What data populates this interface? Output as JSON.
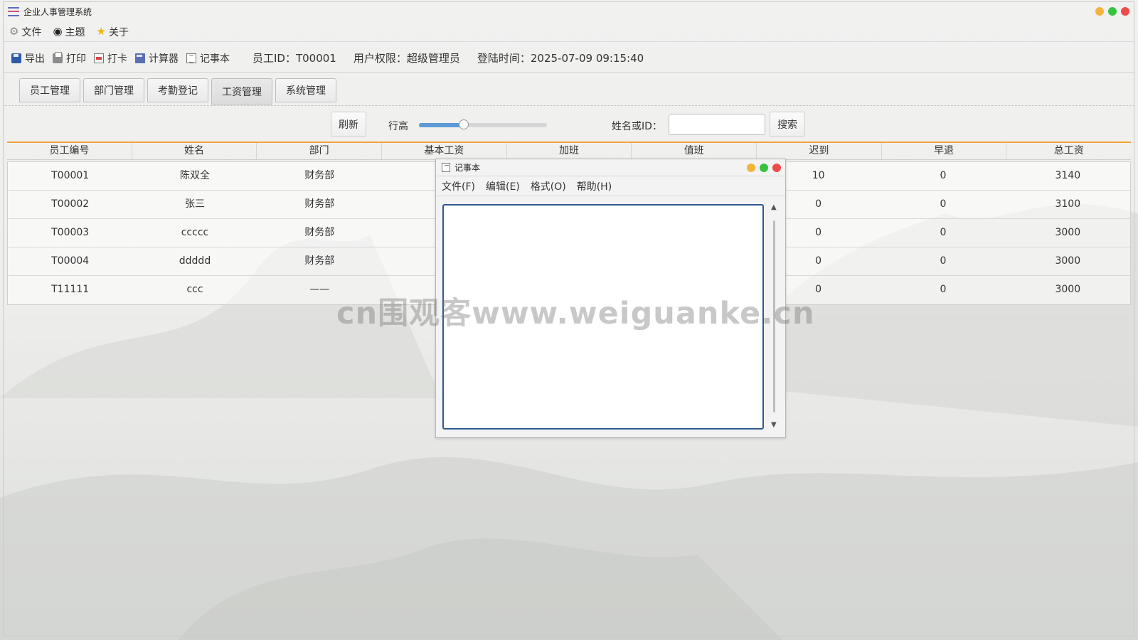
{
  "app": {
    "title": "企业人事管理系统"
  },
  "menubar": [
    {
      "label": "文件",
      "icon": "gear-icon"
    },
    {
      "label": "主题",
      "icon": "eye-icon"
    },
    {
      "label": "关于",
      "icon": "star-icon"
    }
  ],
  "toolbar": {
    "items": [
      {
        "label": "导出",
        "icon": "save-icon"
      },
      {
        "label": "打印",
        "icon": "printer-icon"
      },
      {
        "label": "打卡",
        "icon": "punch-card-icon"
      },
      {
        "label": "计算器",
        "icon": "calculator-icon"
      },
      {
        "label": "记事本",
        "icon": "notepad-icon"
      }
    ],
    "employee_id": "员工ID：T00001",
    "permission": "用户权限：超级管理员",
    "login_time": "登陆时间：2025-07-09 09:15:40"
  },
  "tabs": [
    {
      "label": "员工管理"
    },
    {
      "label": "部门管理"
    },
    {
      "label": "考勤登记"
    },
    {
      "label": "工资管理",
      "active": true
    },
    {
      "label": "系统管理"
    }
  ],
  "controls": {
    "refresh_label": "刷新",
    "row_height_label": "行高",
    "row_height_value": 0.35,
    "search_label": "姓名或ID：",
    "search_value": "",
    "search_button": "搜索"
  },
  "table": {
    "columns": [
      "员工编号",
      "姓名",
      "部门",
      "基本工资",
      "加班",
      "值班",
      "迟到",
      "早退",
      "总工资"
    ],
    "rows": [
      [
        "T00001",
        "陈双全",
        "财务部",
        "",
        "",
        "",
        "10",
        "0",
        "3140"
      ],
      [
        "T00002",
        "张三",
        "财务部",
        "",
        "",
        "",
        "0",
        "0",
        "3100"
      ],
      [
        "T00003",
        "ccccc",
        "财务部",
        "",
        "",
        "",
        "0",
        "0",
        "3000"
      ],
      [
        "T00004",
        "ddddd",
        "财务部",
        "",
        "",
        "",
        "0",
        "0",
        "3000"
      ],
      [
        "T11111",
        "ccc",
        "——",
        "",
        "",
        "",
        "0",
        "0",
        "3000"
      ]
    ]
  },
  "notepad": {
    "title": "记事本",
    "menu": [
      "文件(F)",
      "编辑(E)",
      "格式(O)",
      "帮助(H)"
    ],
    "content": ""
  },
  "watermark": "cn围观客www.weiguanke.cn",
  "colors": {
    "accent": "#f2a33a",
    "slider": "#5d9ad6",
    "editor_border": "#2f5a90"
  }
}
